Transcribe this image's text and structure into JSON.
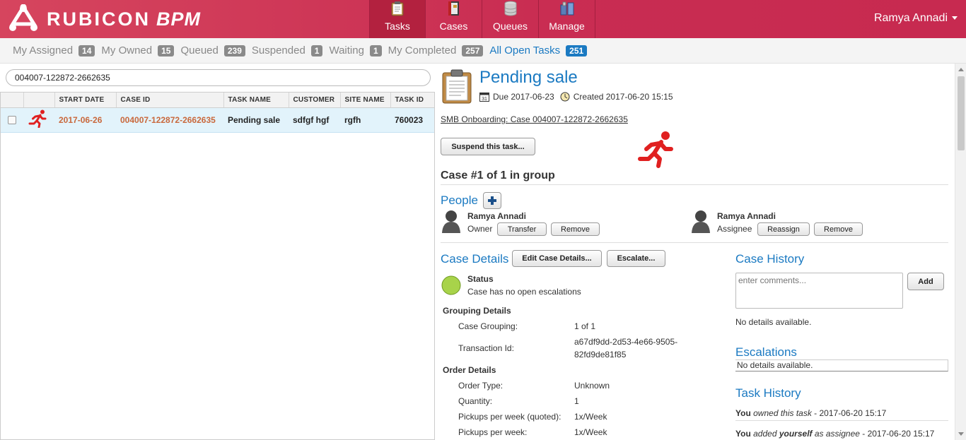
{
  "app": {
    "logo_main": "RUBICON",
    "logo_sub": "BPM",
    "user": "Ramya Annadi"
  },
  "nav": {
    "tasks": "Tasks",
    "cases": "Cases",
    "queues": "Queues",
    "manage": "Manage"
  },
  "filters": [
    {
      "label": "My Assigned",
      "count": "14"
    },
    {
      "label": "My Owned",
      "count": "15"
    },
    {
      "label": "Queued",
      "count": "239"
    },
    {
      "label": "Suspended",
      "count": "1"
    },
    {
      "label": "Waiting",
      "count": "1"
    },
    {
      "label": "My Completed",
      "count": "257"
    },
    {
      "label": "All Open Tasks",
      "count": "251"
    }
  ],
  "search": {
    "value": "004007-122872-2662635"
  },
  "table": {
    "headers": [
      "START DATE",
      "CASE ID",
      "TASK NAME",
      "CUSTOMER",
      "SITE NAME",
      "TASK ID"
    ],
    "rows": [
      {
        "start_date": "2017-06-26",
        "case_id": "004007-122872-2662635",
        "task_name": "Pending sale",
        "customer": "sdfgf hgf",
        "site_name": "rgfh",
        "task_id": "760023"
      }
    ]
  },
  "detail": {
    "title": "Pending sale",
    "due": "Due 2017-06-23",
    "created": "Created 2017-06-20 15:15",
    "case_link": "SMB Onboarding: Case 004007-122872-2662635",
    "suspend_btn": "Suspend this task...",
    "group_heading": "Case #1 of 1 in group",
    "people_heading": "People",
    "people": [
      {
        "name": "Ramya Annadi",
        "role": "Owner",
        "btn1": "Transfer",
        "btn2": "Remove"
      },
      {
        "name": "Ramya Annadi",
        "role": "Assignee",
        "btn1": "Reassign",
        "btn2": "Remove"
      }
    ],
    "case_details_heading": "Case Details",
    "edit_btn": "Edit Case Details...",
    "escalate_btn": "Escalate...",
    "status_label": "Status",
    "status_text": "Case has no open escalations",
    "grouping_heading": "Grouping Details",
    "case_grouping_label": "Case Grouping:",
    "case_grouping_value": "1 of 1",
    "transaction_label": "Transaction Id:",
    "transaction_value_1": "a67df9dd-2d53-4e66-9505-",
    "transaction_value_2": "82fd9de81f85",
    "order_heading": "Order Details",
    "order_rows": [
      {
        "label": "Order Type:",
        "value": "Unknown"
      },
      {
        "label": "Quantity:",
        "value": "1"
      },
      {
        "label": "Pickups per week (quoted):",
        "value": "1x/Week"
      },
      {
        "label": "Pickups per week:",
        "value": "1x/Week"
      }
    ],
    "case_history_heading": "Case History",
    "comments_placeholder": "enter comments...",
    "add_btn": "Add",
    "history_none": "No details available.",
    "escalations_heading": "Escalations",
    "escalations_none": "No details available.",
    "task_history_heading": "Task History",
    "task_history": [
      {
        "who": "You",
        "action": "owned this task",
        "bold_obj": "",
        "rest": "",
        "date": " - 2017-06-20 15:17"
      },
      {
        "who": "You",
        "action": "added",
        "bold_obj": "yourself",
        "rest": "as assignee",
        "date": " - 2017-06-20 15:17"
      }
    ]
  },
  "colors": {
    "brand": "#c92d52",
    "accent": "#1b7ac2",
    "status_ok": "#a8d34a",
    "late_icon": "#e02020"
  }
}
